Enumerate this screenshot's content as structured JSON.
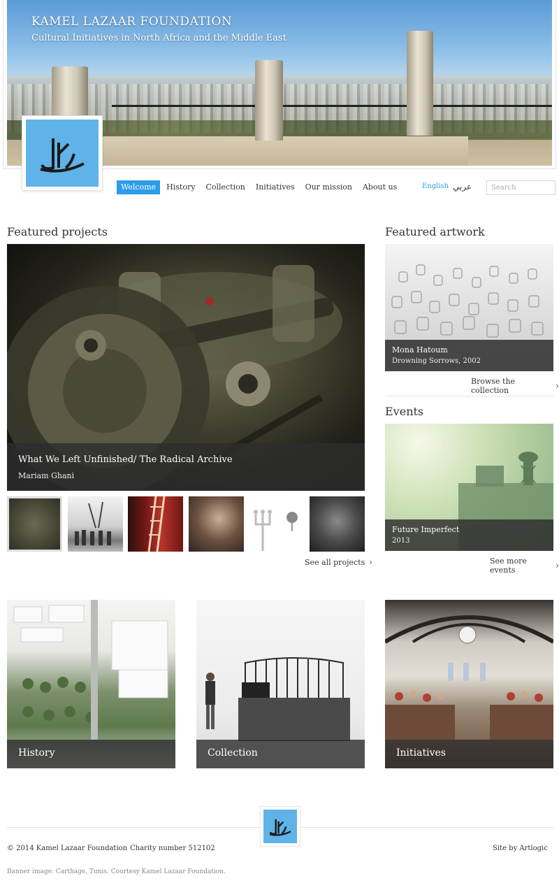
{
  "site": {
    "title": "KAMEL LAZAAR FOUNDATION",
    "subtitle": "Cultural Initiatives in North Africa and the Middle East",
    "logo_color": "#5fb3e8",
    "accent_color": "#2b9cea"
  },
  "nav": {
    "items": [
      {
        "label": "Welcome",
        "active": true
      },
      {
        "label": "History"
      },
      {
        "label": "Collection"
      },
      {
        "label": "Initiatives"
      },
      {
        "label": "Our mission"
      },
      {
        "label": "About us"
      }
    ],
    "lang_en": "English",
    "lang_ar": "عربي",
    "search_placeholder": "Search"
  },
  "featured_projects": {
    "heading": "Featured projects",
    "main_title": "What We Left Unfinished/ The Radical Archive",
    "main_artist": "Mariam Ghani",
    "see_all": "See all projects",
    "thumbnail_count": 6
  },
  "featured_artwork": {
    "heading": "Featured artwork",
    "artist": "Mona Hatoum",
    "work": "Drowning Sorrows, 2002",
    "browse": "Browse the collection"
  },
  "events": {
    "heading": "Events",
    "title": "Future Imperfect",
    "year": "2013",
    "see_more": "See more events"
  },
  "tiles": [
    {
      "label": "History"
    },
    {
      "label": "Collection"
    },
    {
      "label": "Initiatives"
    }
  ],
  "footer": {
    "copyright": "© 2014 Kamel Lazaar Foundation",
    "charity": "Charity number 512102",
    "site_by": "Site by Artlogic",
    "credit": "Banner image: Carthage, Tunis. Courtesy Kamel Lazaar Foundation."
  }
}
